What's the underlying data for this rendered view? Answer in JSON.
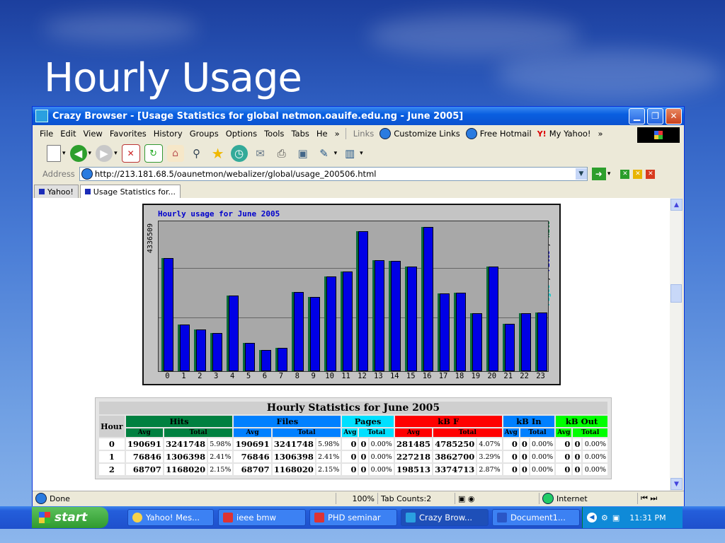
{
  "slide": {
    "title": "Hourly Usage"
  },
  "window": {
    "title": "Crazy Browser - [Usage Statistics for global netmon.oauife.edu.ng - June 2005]",
    "controls": [
      "minimize",
      "restore",
      "close"
    ]
  },
  "menu": {
    "items": [
      "File",
      "Edit",
      "View",
      "Favorites",
      "History",
      "Groups",
      "Options",
      "Tools",
      "Tabs",
      "He"
    ],
    "overflow": "»",
    "links_label": "Links",
    "links": [
      "Customize Links",
      "Free Hotmail",
      "My Yahoo!"
    ]
  },
  "toolbar": {
    "icons": [
      "new-page-icon",
      "back-icon",
      "forward-icon",
      "stop-icon",
      "refresh-icon",
      "home-icon",
      "search-icon",
      "favorites-icon",
      "history-icon",
      "mail-icon",
      "print-icon",
      "edit-icon",
      "tools-icon"
    ]
  },
  "address": {
    "label": "Address",
    "url": "http://213.181.68.5/oaunetmon/webalizer/global/usage_200506.html"
  },
  "tabs": [
    {
      "label": "Yahoo!"
    },
    {
      "label": "Usage Statistics for..."
    }
  ],
  "chart_data": {
    "type": "bar",
    "title": "Hourly usage for June 2005",
    "y_max_label": "4336509",
    "legend": [
      "Pages",
      "Files",
      "Hits"
    ],
    "legend_sep": "/",
    "categories": [
      "0",
      "1",
      "2",
      "3",
      "4",
      "5",
      "6",
      "7",
      "8",
      "9",
      "10",
      "11",
      "12",
      "13",
      "14",
      "15",
      "16",
      "17",
      "18",
      "19",
      "20",
      "21",
      "22",
      "23"
    ],
    "series": [
      {
        "name": "Hits",
        "values": [
          3241748,
          1306398,
          1168020,
          1055000,
          2145000,
          780000,
          580000,
          640000,
          2250000,
          2110000,
          2690000,
          2850000,
          4006000,
          3170000,
          3140000,
          2980000,
          4140000,
          2200000,
          2230000,
          1630000,
          2990000,
          1330000,
          1630000,
          1650000
        ]
      },
      {
        "name": "Files",
        "values": [
          3241748,
          1306398,
          1168020,
          1055000,
          2145000,
          780000,
          580000,
          640000,
          2250000,
          2110000,
          2690000,
          2850000,
          4006000,
          3170000,
          3140000,
          2980000,
          4140000,
          2200000,
          2230000,
          1630000,
          2990000,
          1330000,
          1630000,
          1650000
        ]
      }
    ],
    "ylim": [
      0,
      4336509
    ],
    "grid": true
  },
  "stats": {
    "title": "Hourly Statistics for June 2005",
    "hour_header": "Hour",
    "groups": [
      "Hits",
      "Files",
      "Pages",
      "kB F",
      "kB In",
      "kB Out"
    ],
    "group_colors": {
      "hits": "#008040",
      "files": "#0080ff",
      "pages": "#00e0ff",
      "kbf": "#ff0000",
      "kbin": "#0080ff",
      "kbout": "#00ff00"
    },
    "sub": {
      "avg": "Avg",
      "total": "Total"
    },
    "rows": [
      {
        "hour": "0",
        "hits_avg": "190691",
        "hits_total": "3241748",
        "hits_pct": "5.98%",
        "files_avg": "190691",
        "files_total": "3241748",
        "files_pct": "5.98%",
        "pages_avg": "0",
        "pages_total": "0",
        "pages_pct": "0.00%",
        "kbf_avg": "281485",
        "kbf_total": "4785250",
        "kbf_pct": "4.07%",
        "kbin_avg": "0",
        "kbin_total": "0",
        "kbin_pct": "0.00%",
        "kbout_avg": "0",
        "kbout_total": "0",
        "kbout_pct": "0.00%"
      },
      {
        "hour": "1",
        "hits_avg": "76846",
        "hits_total": "1306398",
        "hits_pct": "2.41%",
        "files_avg": "76846",
        "files_total": "1306398",
        "files_pct": "2.41%",
        "pages_avg": "0",
        "pages_total": "0",
        "pages_pct": "0.00%",
        "kbf_avg": "227218",
        "kbf_total": "3862700",
        "kbf_pct": "3.29%",
        "kbin_avg": "0",
        "kbin_total": "0",
        "kbin_pct": "0.00%",
        "kbout_avg": "0",
        "kbout_total": "0",
        "kbout_pct": "0.00%"
      },
      {
        "hour": "2",
        "hits_avg": "68707",
        "hits_total": "1168020",
        "hits_pct": "2.15%",
        "files_avg": "68707",
        "files_total": "1168020",
        "files_pct": "2.15%",
        "pages_avg": "0",
        "pages_total": "0",
        "pages_pct": "0.00%",
        "kbf_avg": "198513",
        "kbf_total": "3374713",
        "kbf_pct": "2.87%",
        "kbin_avg": "0",
        "kbin_total": "0",
        "kbin_pct": "0.00%",
        "kbout_avg": "0",
        "kbout_total": "0",
        "kbout_pct": "0.00%"
      }
    ]
  },
  "statusbar": {
    "status": "Done",
    "zoom": "100%",
    "tab_counts": "Tab Counts:2",
    "zone": "Internet"
  },
  "taskbar": {
    "start": "start",
    "tasks": [
      "Yahoo! Mes...",
      "ieee bmw",
      "PHD seminar",
      "Crazy Brow...",
      "Document1..."
    ],
    "active_task": "Crazy Brow...",
    "clock": "11:31 PM"
  }
}
